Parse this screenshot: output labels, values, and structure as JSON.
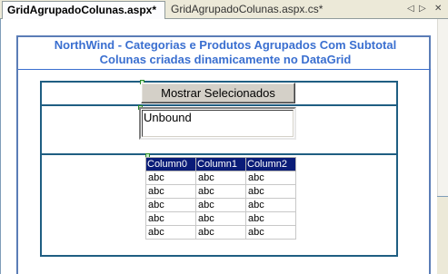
{
  "tabs": {
    "active": "GridAgrupadoColunas.aspx*",
    "inactive": "GridAgrupadoColunas.aspx.cs*",
    "prev_glyph": "◁",
    "next_glyph": "▷",
    "close_glyph": "✕"
  },
  "page": {
    "title_line1": "NorthWind - Categorias e Produtos Agrupados Com Subtotal",
    "title_line2": "Colunas criadas dinamicamente no DataGrid",
    "title_color": "#3a6fd0"
  },
  "button": {
    "label": "Mostrar Selecionados"
  },
  "listbox": {
    "text": "Unbound"
  },
  "datagrid": {
    "header_color": "#0a1c78",
    "columns": [
      "Column0",
      "Column1",
      "Column2"
    ],
    "rows": [
      [
        "abc",
        "abc",
        "abc"
      ],
      [
        "abc",
        "abc",
        "abc"
      ],
      [
        "abc",
        "abc",
        "abc"
      ],
      [
        "abc",
        "abc",
        "abc"
      ],
      [
        "abc",
        "abc",
        "abc"
      ]
    ]
  }
}
